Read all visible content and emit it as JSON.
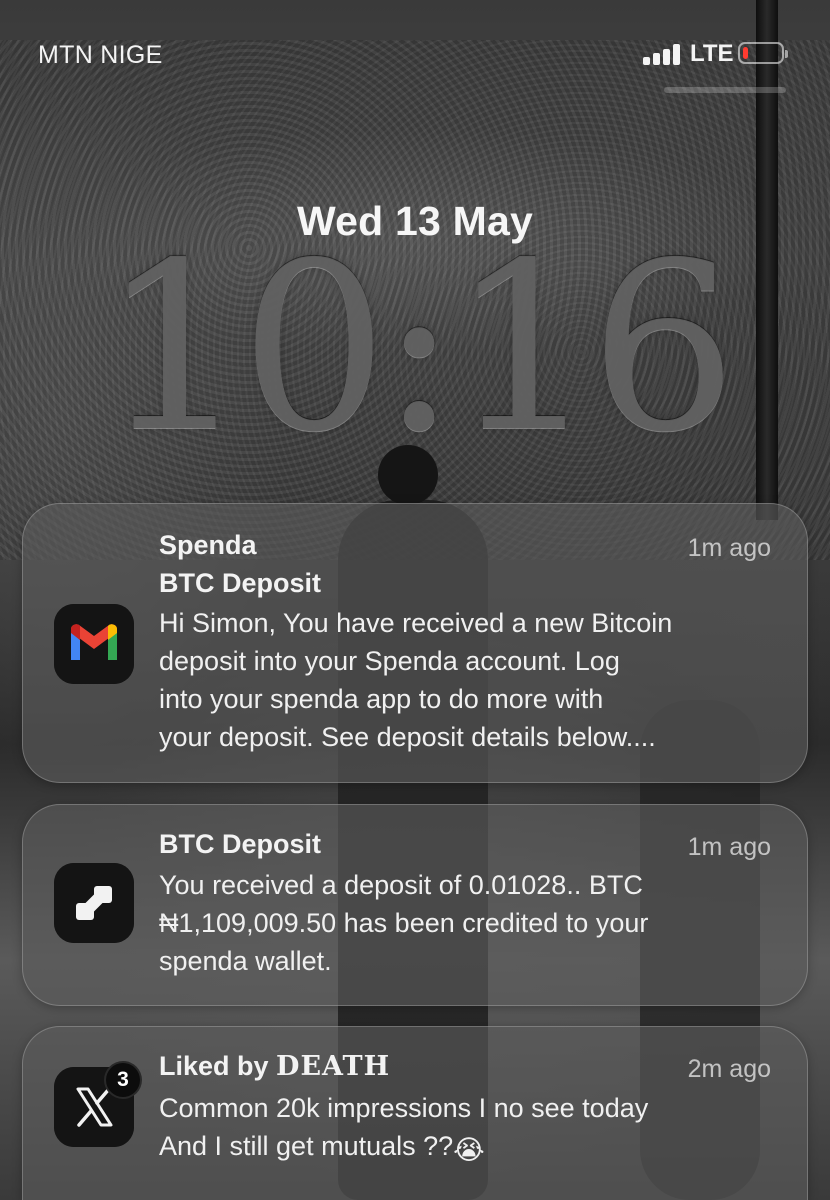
{
  "status_bar": {
    "carrier": "MTN NIGE",
    "network": "LTE",
    "signal_bars": 4,
    "battery_level": 0.15,
    "battery_color": "#ff3b30"
  },
  "lock_screen": {
    "date": "Wed 13 May",
    "time": "10:16"
  },
  "notifications": [
    {
      "app_icon": "gmail-icon",
      "title": "Spenda",
      "time": "1m ago",
      "subtitle": "BTC Deposit",
      "body_lines": [
        "Hi Simon, You have received a new Bitcoin",
        "deposit into your Spenda account. Log",
        "into your spenda app to do more with",
        "your deposit. See deposit details below...."
      ]
    },
    {
      "app_icon": "spenda-icon",
      "title": "BTC Deposit",
      "time": "1m ago",
      "body_lines": [
        "You received a deposit of 0.01028.. BTC",
        "₦1,109,009.50 has been credited to your",
        "spenda wallet."
      ]
    },
    {
      "app_icon": "x-icon",
      "title_prefix": "Liked by",
      "title_name": "DEATH",
      "time": "2m ago",
      "badge_count": "3",
      "body_lines": [
        "Common 20k impressions I no see today",
        "And I still get mutuals ??"
      ],
      "emoji": "😭"
    }
  ]
}
